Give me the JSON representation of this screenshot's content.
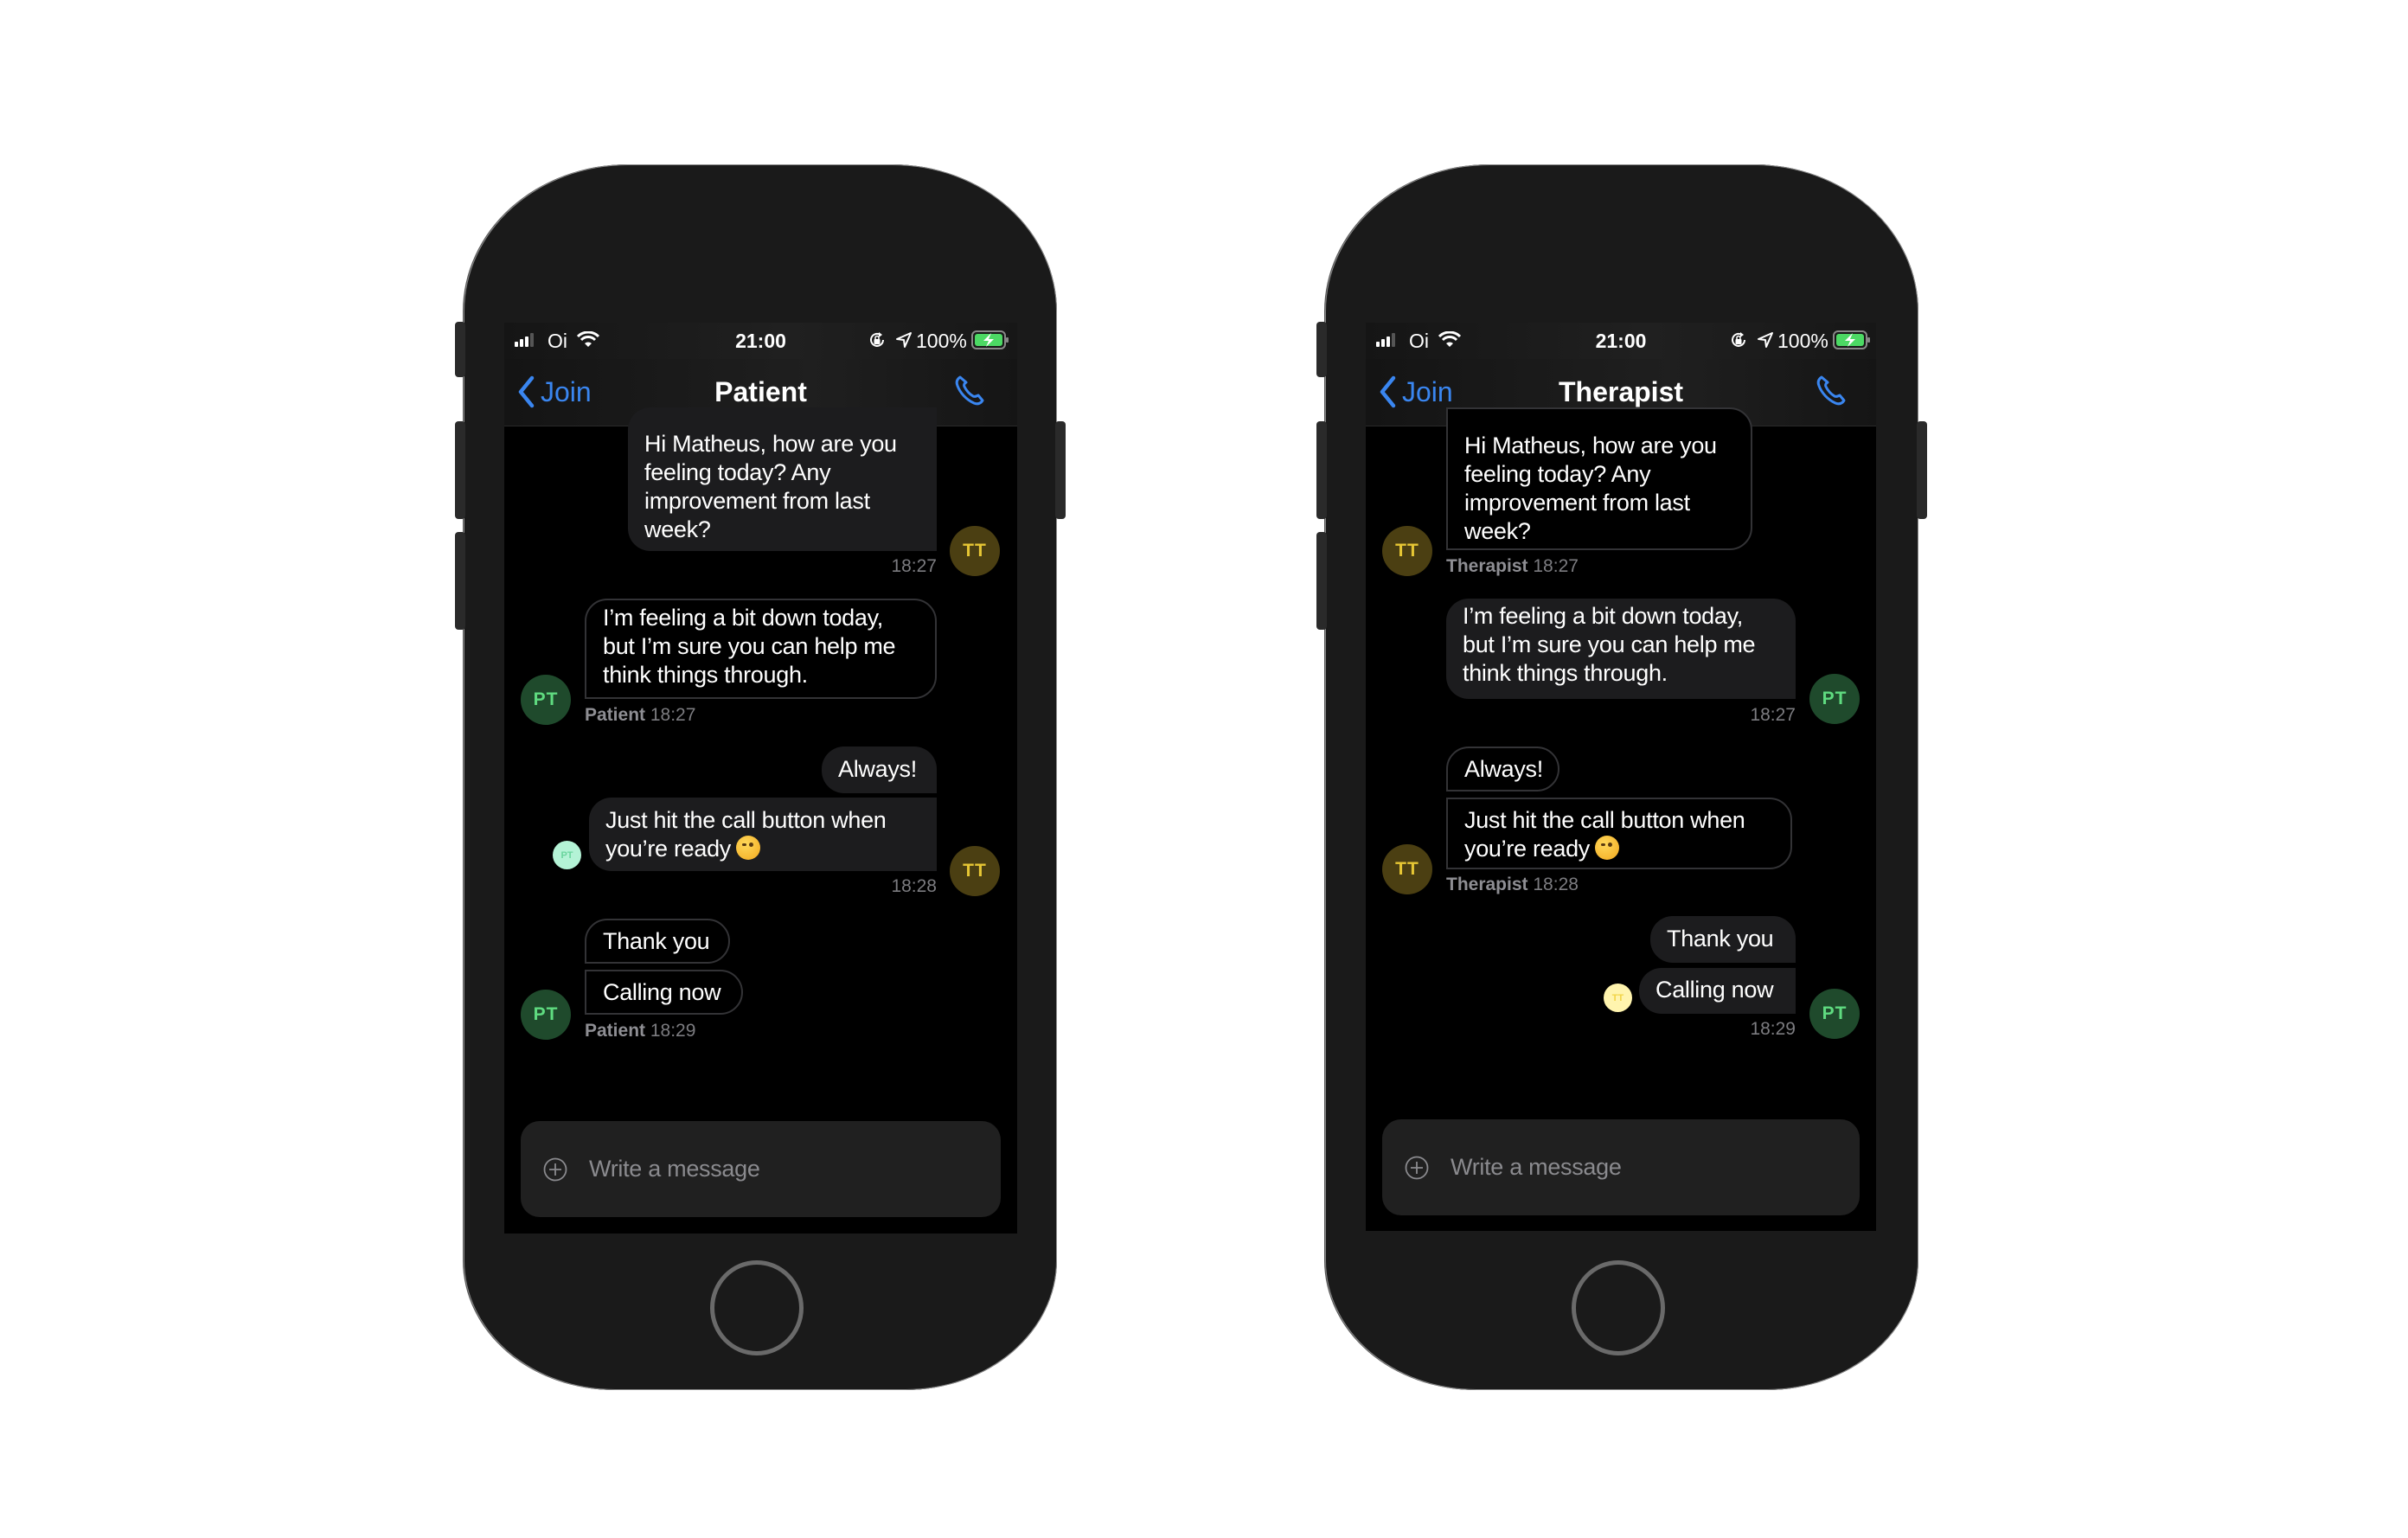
{
  "status_bar": {
    "carrier": "Oi",
    "time": "21:00",
    "battery_percent": "100%",
    "icons": [
      "signal-icon",
      "wifi-icon",
      "rotation-lock-icon",
      "location-icon",
      "battery-charging-icon"
    ]
  },
  "colors": {
    "accent": "#3a86f0",
    "therapist_avatar_bg": "#4b3f12",
    "therapist_avatar_fg": "#e6c634",
    "patient_avatar_bg": "#1f4a2c",
    "patient_avatar_fg": "#5fdb80",
    "bubble_filled": "#1c1c1e",
    "battery_green": "#4cd964"
  },
  "phones": [
    {
      "view": "patient",
      "nav": {
        "back_label": "Join",
        "title": "Patient"
      },
      "messages": [
        {
          "sender": "therapist",
          "initials": "TT",
          "text": "Hi Matheus, how are you feeling today? Any improvement from last week?",
          "time": "18:27"
        },
        {
          "sender": "patient",
          "initials": "PT",
          "text": "I’m feeling a bit down today, but I’m sure you can help me think things through.",
          "name": "Patient",
          "time": "18:27"
        },
        {
          "sender": "therapist",
          "initials": "TT",
          "texts": [
            "Always!",
            "Just hit the call button when you’re ready"
          ],
          "emoji": "😉",
          "time": "18:28",
          "read_by": "PT"
        },
        {
          "sender": "patient",
          "initials": "PT",
          "texts": [
            "Thank you",
            "Calling now"
          ],
          "name": "Patient",
          "time": "18:29"
        }
      ],
      "composer": {
        "placeholder": "Write a message"
      }
    },
    {
      "view": "therapist",
      "nav": {
        "back_label": "Join",
        "title": "Therapist"
      },
      "messages": [
        {
          "sender": "therapist",
          "initials": "TT",
          "text": "Hi Matheus, how are you feeling today? Any improvement from last week?",
          "name": "Therapist",
          "time": "18:27"
        },
        {
          "sender": "patient",
          "initials": "PT",
          "text": "I’m feeling a bit down today, but I’m sure you can help me think things through.",
          "time": "18:27"
        },
        {
          "sender": "therapist",
          "initials": "TT",
          "texts": [
            "Always!",
            "Just hit the call button when you’re ready"
          ],
          "emoji": "😉",
          "name": "Therapist",
          "time": "18:28"
        },
        {
          "sender": "patient",
          "initials": "PT",
          "texts": [
            "Thank you",
            "Calling now"
          ],
          "time": "18:29",
          "read_by": "TT"
        }
      ],
      "composer": {
        "placeholder": "Write a message"
      }
    }
  ]
}
